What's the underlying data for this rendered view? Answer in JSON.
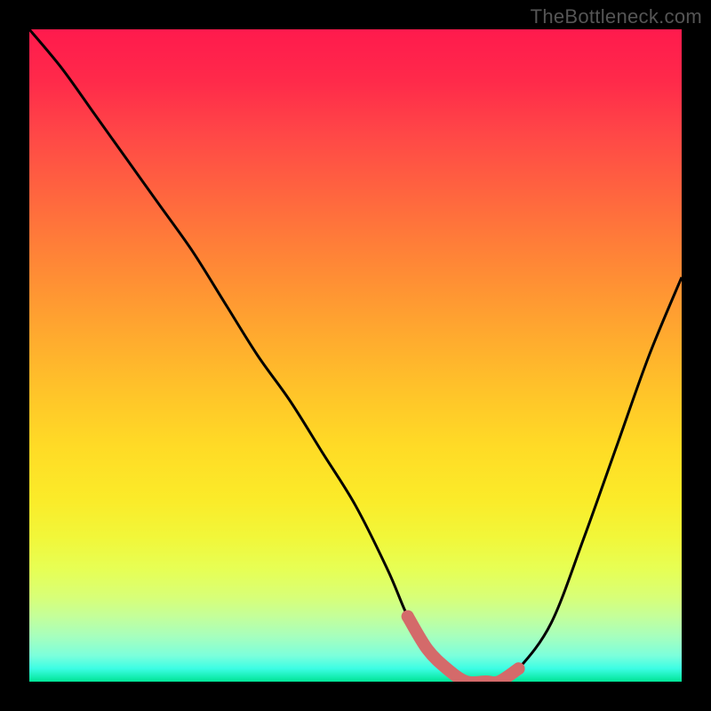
{
  "watermark": "TheBottleneck.com",
  "chart_data": {
    "type": "line",
    "title": "",
    "xlabel": "",
    "ylabel": "",
    "xlim": [
      0,
      100
    ],
    "ylim": [
      0,
      100
    ],
    "x": [
      0,
      5,
      10,
      15,
      20,
      25,
      30,
      35,
      40,
      45,
      50,
      55,
      58,
      61,
      64,
      67,
      70,
      72,
      75,
      80,
      85,
      90,
      95,
      100
    ],
    "values": [
      100,
      94,
      87,
      80,
      73,
      66,
      58,
      50,
      43,
      35,
      27,
      17,
      10,
      5,
      2,
      0,
      0,
      0,
      2,
      9,
      22,
      36,
      50,
      62
    ],
    "highlight_region": {
      "x_start": 58,
      "x_end": 75
    },
    "gradient": {
      "top": "#ff1a4d",
      "mid": "#ffdb26",
      "bottom": "#00e596"
    }
  }
}
